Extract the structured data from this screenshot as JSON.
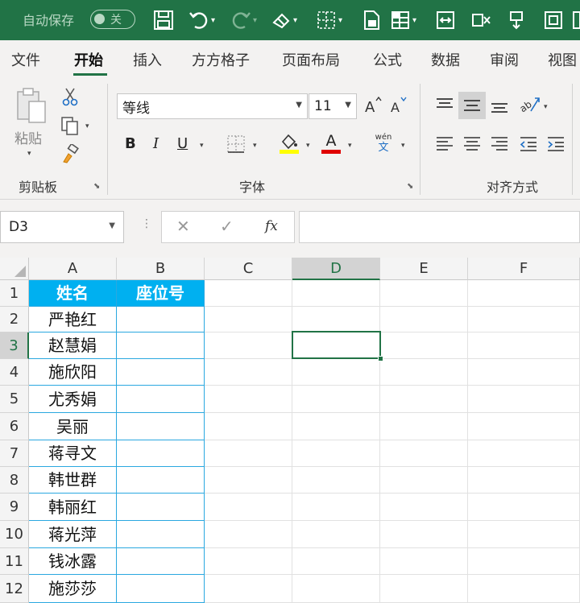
{
  "titlebar": {
    "autosave_label": "自动保存",
    "autosave_state": "关"
  },
  "ribbon_tabs": [
    "文件",
    "开始",
    "插入",
    "方方格子",
    "页面布局",
    "公式",
    "数据",
    "审阅",
    "视图"
  ],
  "active_tab": "开始",
  "clipboard": {
    "paste_label": "粘贴",
    "group_label": "剪贴板"
  },
  "font": {
    "name": "等线",
    "size": "11",
    "group_label": "字体",
    "bold": "B",
    "italic": "I",
    "underline": "U",
    "font_color_glyph": "A",
    "phonetic_top": "wén",
    "phonetic_bottom": "文",
    "fill_color": "#ffff00",
    "font_color": "#e00000"
  },
  "alignment": {
    "group_label": "对齐方式"
  },
  "formula_bar": {
    "name_box": "D3",
    "cancel": "✕",
    "enter": "✓",
    "fx": "fx",
    "formula": ""
  },
  "sheet": {
    "columns": [
      "A",
      "B",
      "C",
      "D",
      "E",
      "F"
    ],
    "rows": [
      "1",
      "2",
      "3",
      "4",
      "5",
      "6",
      "7",
      "8",
      "9",
      "10",
      "11",
      "12"
    ],
    "selected_cell": "D3",
    "header": {
      "name": "姓名",
      "seat": "座位号"
    },
    "names": [
      "严艳红",
      "赵慧娟",
      "施欣阳",
      "尤秀娟",
      "吴丽",
      "蒋寻文",
      "韩世群",
      "韩丽红",
      "蒋光萍",
      "钱冰露",
      "施莎莎"
    ],
    "header_fill": "#00b0f0",
    "table_border": "#2aa8e0"
  }
}
